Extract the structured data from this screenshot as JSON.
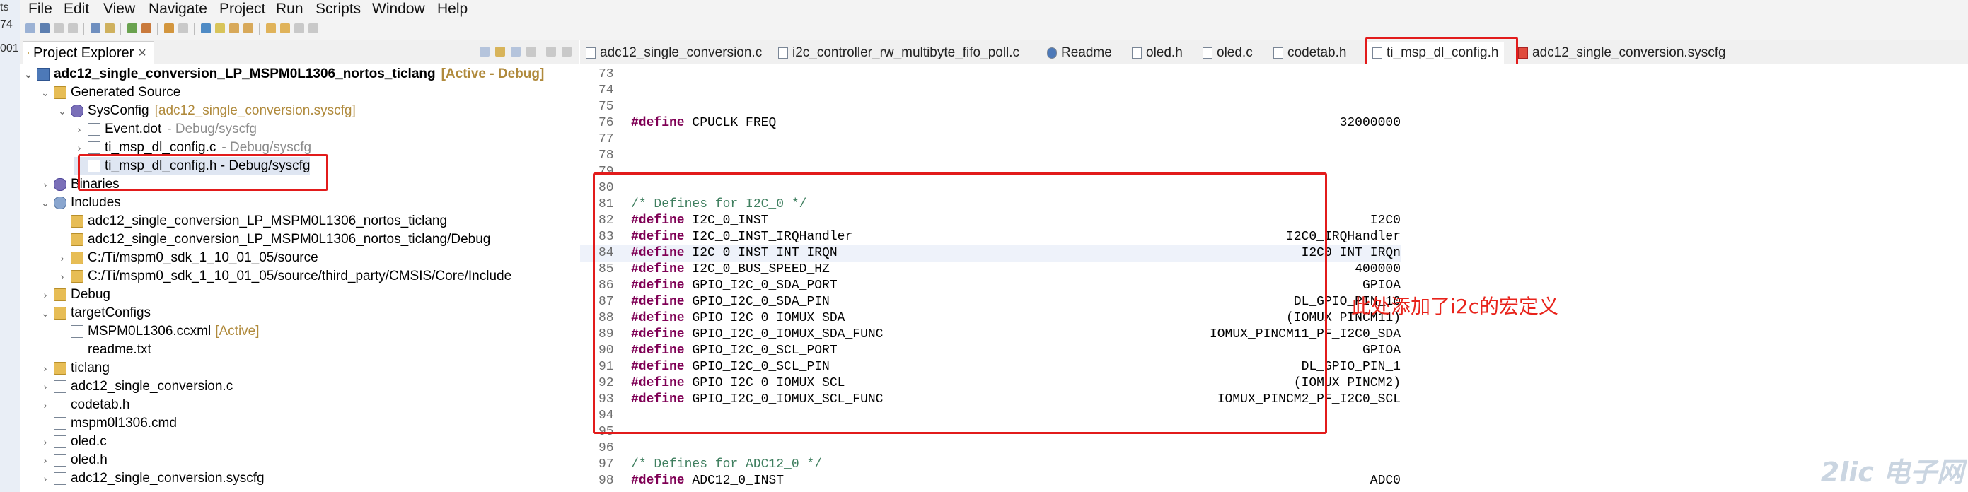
{
  "left_strip": {
    "fragments": [
      "ts",
      "74",
      "001"
    ]
  },
  "menu": [
    {
      "label": "File"
    },
    {
      "label": "Edit"
    },
    {
      "label": "View"
    },
    {
      "label": "Navigate"
    },
    {
      "label": "Project"
    },
    {
      "label": "Run"
    },
    {
      "label": "Scripts"
    },
    {
      "label": "Window"
    },
    {
      "label": "Help"
    }
  ],
  "explorer": {
    "title": "Project Explorer",
    "close_glyph": "×",
    "tree": [
      {
        "label": "adc12_single_conversion_LP_MSPM0L1306_nortos_ticlang",
        "decoration": "[Active - Debug]",
        "icon": "project-icon"
      },
      {
        "label": "Generated Source",
        "decoration": "",
        "icon": "folder-icon"
      },
      {
        "label": "SysConfig",
        "decoration": "[adc12_single_conversion.syscfg]",
        "icon": "gear-icon"
      },
      {
        "label": "Event.dot",
        "decoration": "- Debug/syscfg",
        "icon": "file-icon"
      },
      {
        "label": "ti_msp_dl_config.c",
        "decoration": "- Debug/syscfg",
        "icon": "file-icon"
      },
      {
        "label": "ti_msp_dl_config.h - Debug/syscfg",
        "decoration": "",
        "icon": "file-icon"
      },
      {
        "label": "Binaries",
        "decoration": "",
        "icon": "gear-icon"
      },
      {
        "label": "Includes",
        "decoration": "",
        "icon": "include-icon"
      },
      {
        "label": "adc12_single_conversion_LP_MSPM0L1306_nortos_ticlang",
        "decoration": "",
        "icon": "folder-icon"
      },
      {
        "label": "adc12_single_conversion_LP_MSPM0L1306_nortos_ticlang/Debug",
        "decoration": "",
        "icon": "folder-icon"
      },
      {
        "label": "C:/Ti/mspm0_sdk_1_10_01_05/source",
        "decoration": "",
        "icon": "folder-icon"
      },
      {
        "label": "C:/Ti/mspm0_sdk_1_10_01_05/source/third_party/CMSIS/Core/Include",
        "decoration": "",
        "icon": "folder-icon"
      },
      {
        "label": "Debug",
        "decoration": "",
        "icon": "folder-icon"
      },
      {
        "label": "targetConfigs",
        "decoration": "",
        "icon": "folder-icon"
      },
      {
        "label": "MSPM0L1306.ccxml",
        "decoration": "[Active]",
        "icon": "file-icon"
      },
      {
        "label": "readme.txt",
        "decoration": "",
        "icon": "file-icon"
      },
      {
        "label": "ticlang",
        "decoration": "",
        "icon": "folder-icon"
      },
      {
        "label": "adc12_single_conversion.c",
        "decoration": "",
        "icon": "file-icon"
      },
      {
        "label": "codetab.h",
        "decoration": "",
        "icon": "file-icon"
      },
      {
        "label": "mspm0l1306.cmd",
        "decoration": "",
        "icon": "file-icon"
      },
      {
        "label": "oled.c",
        "decoration": "",
        "icon": "file-icon"
      },
      {
        "label": "oled.h",
        "decoration": "",
        "icon": "file-icon"
      },
      {
        "label": "adc12_single_conversion.syscfg",
        "decoration": "",
        "icon": "file-icon"
      }
    ]
  },
  "editor_tabs": [
    {
      "label": "adc12_single_conversion.c"
    },
    {
      "label": "i2c_controller_rw_multibyte_fifo_poll.c"
    },
    {
      "label": "Readme"
    },
    {
      "label": "oled.h"
    },
    {
      "label": "oled.c"
    },
    {
      "label": "codetab.h"
    },
    {
      "label": "ti_msp_dl_config.h"
    },
    {
      "label": "adc12_single_conversion.syscfg"
    }
  ],
  "code_lines": [
    {
      "n": "73",
      "kw": "",
      "text": "",
      "value": ""
    },
    {
      "n": "74",
      "kw": "",
      "text": "",
      "value": ""
    },
    {
      "n": "75",
      "kw": "",
      "text": "",
      "value": ""
    },
    {
      "n": "76",
      "kw": "#define",
      "text": " CPUCLK_FREQ",
      "value": "32000000"
    },
    {
      "n": "77",
      "kw": "",
      "text": "",
      "value": ""
    },
    {
      "n": "78",
      "kw": "",
      "text": "",
      "value": ""
    },
    {
      "n": "79",
      "kw": "",
      "text": "",
      "value": ""
    },
    {
      "n": "80",
      "kw": "",
      "text": "",
      "value": ""
    },
    {
      "n": "81",
      "kw": "",
      "comment": "/* Defines for I2C_0 */",
      "text": "",
      "value": ""
    },
    {
      "n": "82",
      "kw": "#define",
      "text": " I2C_0_INST",
      "value": "I2C0"
    },
    {
      "n": "83",
      "kw": "#define",
      "text": " I2C_0_INST_IRQHandler",
      "value": "I2C0_IRQHandler"
    },
    {
      "n": "84",
      "kw": "#define",
      "text": " I2C_0_INST_INT_IRQN",
      "value": "I2C0_INT_IRQn"
    },
    {
      "n": "85",
      "kw": "#define",
      "text": " I2C_0_BUS_SPEED_HZ",
      "value": "400000"
    },
    {
      "n": "86",
      "kw": "#define",
      "text": " GPIO_I2C_0_SDA_PORT",
      "value": "GPIOA"
    },
    {
      "n": "87",
      "kw": "#define",
      "text": " GPIO_I2C_0_SDA_PIN",
      "value": "DL_GPIO_PIN_10"
    },
    {
      "n": "88",
      "kw": "#define",
      "text": " GPIO_I2C_0_IOMUX_SDA",
      "value": "(IOMUX_PINCM11)"
    },
    {
      "n": "89",
      "kw": "#define",
      "text": " GPIO_I2C_0_IOMUX_SDA_FUNC",
      "value": "IOMUX_PINCM11_PF_I2C0_SDA"
    },
    {
      "n": "90",
      "kw": "#define",
      "text": " GPIO_I2C_0_SCL_PORT",
      "value": "GPIOA"
    },
    {
      "n": "91",
      "kw": "#define",
      "text": " GPIO_I2C_0_SCL_PIN",
      "value": "DL_GPIO_PIN_1"
    },
    {
      "n": "92",
      "kw": "#define",
      "text": " GPIO_I2C_0_IOMUX_SCL",
      "value": "(IOMUX_PINCM2)"
    },
    {
      "n": "93",
      "kw": "#define",
      "text": " GPIO_I2C_0_IOMUX_SCL_FUNC",
      "value": "IOMUX_PINCM2_PF_I2C0_SCL"
    },
    {
      "n": "94",
      "kw": "",
      "text": "",
      "value": ""
    },
    {
      "n": "95",
      "kw": "",
      "text": "",
      "value": ""
    },
    {
      "n": "96",
      "kw": "",
      "text": "",
      "value": ""
    },
    {
      "n": "97",
      "kw": "",
      "comment": "/* Defines for ADC12_0 */",
      "text": "",
      "value": ""
    },
    {
      "n": "98",
      "kw": "#define",
      "text": " ADC12_0_INST",
      "value": "ADC0"
    }
  ],
  "annotation": "此处添加了i2c的宏定义",
  "watermark": "2lic 电子网",
  "colors": {
    "highlight": "#e21b1b",
    "keyword": "#7f0055",
    "comment": "#3f7f5f"
  }
}
